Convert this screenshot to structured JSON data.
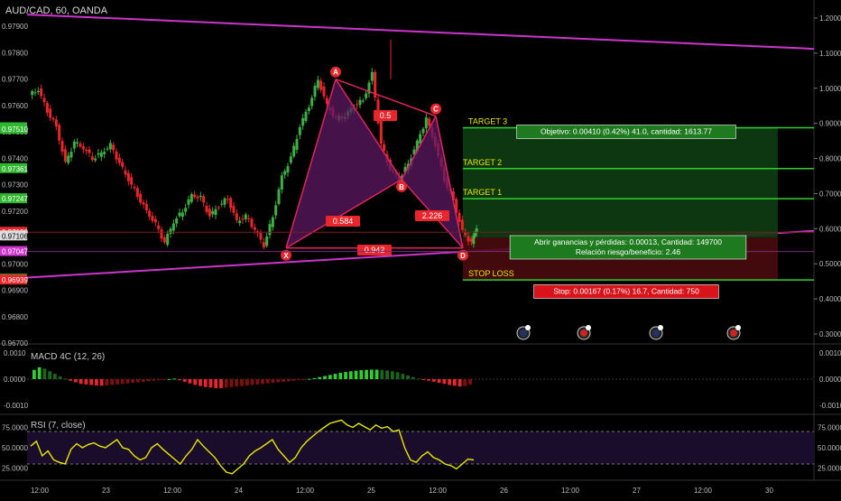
{
  "chart_title": "AUD/CAD, 60, OANDA",
  "colors": {
    "bg": "#000000",
    "bull": "#3cb043",
    "bear": "#e8262b",
    "pattern": "#e0245e",
    "pattern_fill": "#5c1a63",
    "channel": "#cc35cc",
    "target": "#2fd12f",
    "stop": "#2fd12f",
    "rsi": "#e8e800",
    "rsi_band": "#1a0d2b"
  },
  "chart_data": [
    {
      "type": "candlestick",
      "title": "AUD/CAD, 60, OANDA",
      "x_tick_labels": [
        "12:00",
        "23",
        "12:00",
        "24",
        "12:00",
        "25",
        "12:00",
        "26",
        "12:00",
        "27",
        "12:00",
        "30"
      ],
      "y_tick_labels": [
        "0.97900",
        "0.97800",
        "0.97700",
        "0.97600",
        "0.97500",
        "0.97400",
        "0.97300",
        "0.97200",
        "0.97100",
        "0.97000",
        "0.96900",
        "0.96800",
        "0.96700"
      ],
      "ylim": [
        0.967,
        0.98
      ],
      "right_scale_labels": [
        "1.2000",
        "1.1000",
        "1.0000",
        "0.9000",
        "0.8000",
        "0.7000",
        "0.6000",
        "0.5000",
        "0.4000",
        "0.3000"
      ],
      "price_badges": [
        {
          "value": "0.97516",
          "color": "#2fb82f"
        },
        {
          "value": "0.97510",
          "color": "#2fb82f"
        },
        {
          "value": "0.97361",
          "color": "#2fb82f"
        },
        {
          "value": "0.97247",
          "color": "#2fb82f"
        },
        {
          "value": "0.97120",
          "color": "#e8262b"
        },
        {
          "value": "0.97106",
          "color": "#dddddd"
        },
        {
          "value": "0.97047",
          "color": "#cc35cc"
        },
        {
          "value": "0.96942",
          "color": "#2fb82f"
        },
        {
          "value": "0.96939",
          "color": "#e8262b"
        }
      ],
      "harmonic_pattern": {
        "points": [
          {
            "label": "X",
            "price": 0.9706
          },
          {
            "label": "A",
            "price": 0.977
          },
          {
            "label": "B",
            "price": 0.9732
          },
          {
            "label": "C",
            "price": 0.9756
          },
          {
            "label": "D",
            "price": 0.9706
          }
        ],
        "ratios": [
          "0.5",
          "0.584",
          "2.226",
          "0.942"
        ]
      },
      "targets": [
        {
          "label": "TARGET 3",
          "price": 0.97516
        },
        {
          "label": "TARGET 2",
          "price": 0.97361
        },
        {
          "label": "TARGET 1",
          "price": 0.97247
        },
        {
          "label": "STOP LOSS",
          "price": 0.96939
        }
      ],
      "trade_labels": {
        "objective": "Objetivo: 0.00410 (0.42%) 41.0, cantidad: 1613.77",
        "open_pnl_line1": "Abrir ganancias y pérdidas: 0.00013, Cantidad: 149700",
        "open_pnl_line2": "Relación riesgo/beneficio: 2.46",
        "stop": "Stop: 0.00167 (0.17%) 16.7, Cantidad: 750"
      },
      "event_icons": [
        "flag-icon",
        "flag-icon",
        "flag-icon",
        "flag-icon"
      ]
    },
    {
      "type": "bar",
      "title": "MACD 4C (12, 26)",
      "y_tick_labels": [
        "0.0010",
        "0.0000",
        "-0.0010"
      ],
      "ylim": [
        -0.0013,
        0.0013
      ],
      "series": [
        {
          "values": [
            0.00035,
            0.00045,
            0.0004,
            0.0003,
            0.0002,
            0.0001,
            2e-05,
            -6e-05,
            -0.00012,
            -0.00018,
            -0.0002,
            -0.00022,
            -0.00024,
            -0.00025,
            -0.00024,
            -0.00022,
            -0.0002,
            -0.00018,
            -0.00016,
            -0.00014,
            -0.00012,
            -0.0001,
            -8e-05,
            -6e-05,
            -4e-05,
            -2e-05,
            0.0,
            2e-05,
            -4e-05,
            -0.0001,
            -0.00016,
            -0.00022,
            -0.00026,
            -0.0003,
            -0.00032,
            -0.00034,
            -0.00034,
            -0.00032,
            -0.0003,
            -0.00028,
            -0.00026,
            -0.00024,
            -0.00022,
            -0.0002,
            -0.00018,
            -0.00016,
            -0.00014,
            -0.00012,
            -0.0001,
            -8e-05,
            -6e-05,
            -4e-05,
            -2e-05,
            1e-05,
            4e-05,
            8e-05,
            0.00012,
            0.00016,
            0.0002,
            0.00024,
            0.00027,
            0.0003,
            0.00032,
            0.00034,
            0.00035,
            0.00036,
            0.00036,
            0.00035,
            0.00033,
            0.0003,
            0.00026,
            0.0002,
            0.00014,
            8e-05,
            2e-05,
            -2e-05,
            -6e-05,
            -0.0001,
            -0.00014,
            -0.00018,
            -0.00022,
            -0.00025,
            -0.00028,
            -0.00026,
            -0.0002
          ]
        }
      ]
    },
    {
      "type": "line",
      "title": "RSI (7, close)",
      "y_tick_labels": [
        "75.0000",
        "50.0000",
        "25.0000"
      ],
      "ylim": [
        10,
        90
      ],
      "series": [
        {
          "values": [
            52,
            58,
            40,
            46,
            35,
            32,
            30,
            48,
            55,
            50,
            54,
            56,
            52,
            50,
            55,
            60,
            50,
            48,
            40,
            35,
            38,
            50,
            55,
            48,
            42,
            36,
            30,
            40,
            48,
            60,
            52,
            45,
            38,
            28,
            20,
            18,
            24,
            30,
            40,
            46,
            50,
            55,
            60,
            48,
            40,
            32,
            38,
            50,
            58,
            64,
            70,
            75,
            80,
            82,
            84,
            78,
            75,
            80,
            76,
            72,
            78,
            74,
            76,
            70,
            72,
            50,
            35,
            32,
            40,
            45,
            38,
            35,
            30,
            28,
            24,
            30,
            36,
            35
          ]
        }
      ]
    }
  ]
}
